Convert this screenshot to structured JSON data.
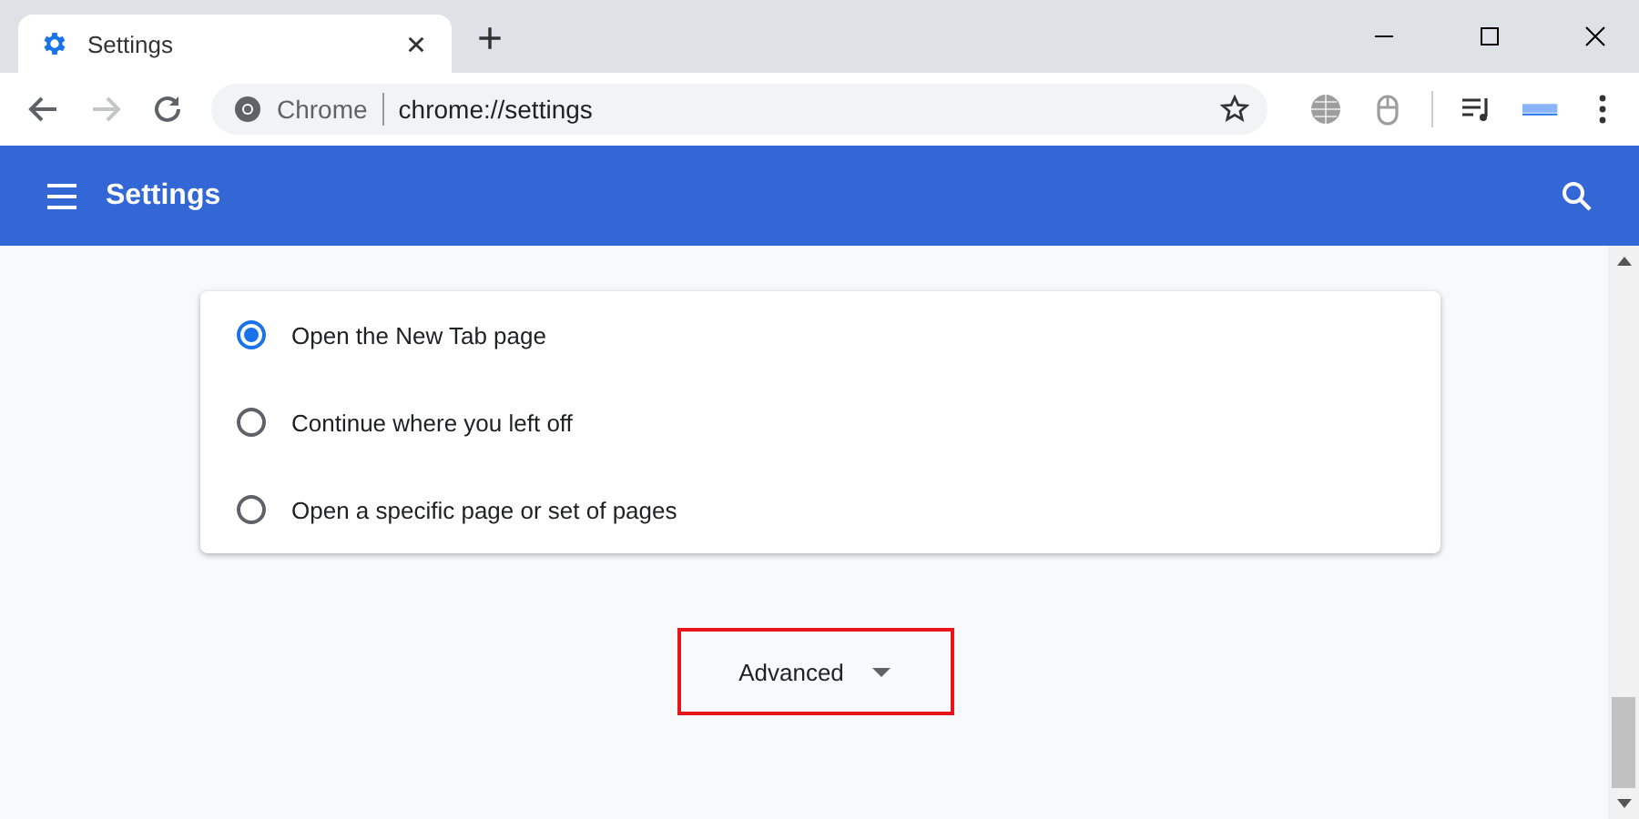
{
  "window": {
    "tab_title": "Settings",
    "new_tab_symbol": "+"
  },
  "address_bar": {
    "site_label": "Chrome",
    "url": "chrome://settings"
  },
  "header": {
    "title": "Settings"
  },
  "startup_options": [
    {
      "label": "Open the New Tab page",
      "selected": true
    },
    {
      "label": "Continue where you left off",
      "selected": false
    },
    {
      "label": "Open a specific page or set of pages",
      "selected": false
    }
  ],
  "advanced": {
    "label": "Advanced",
    "highlighted": true
  }
}
